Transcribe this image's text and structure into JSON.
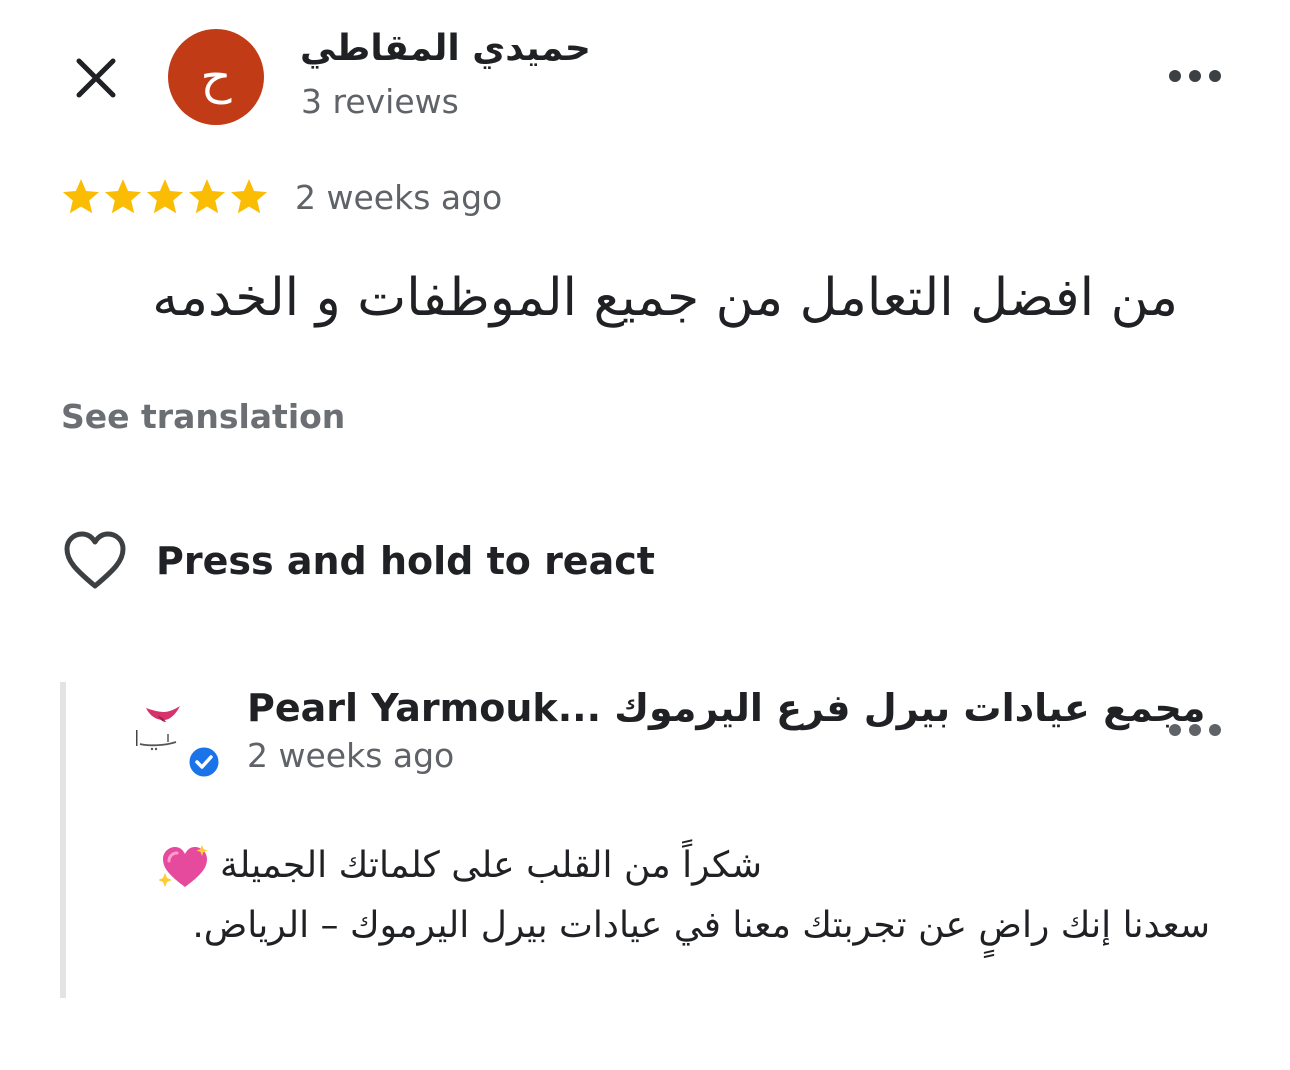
{
  "header": {
    "close_icon": "close-icon",
    "more_icon": "more-horizontal-icon"
  },
  "reviewer": {
    "avatar_letter": "ح",
    "avatar_color": "#c23b17",
    "name": "حميدي المقاطي",
    "meta": "3 reviews"
  },
  "review": {
    "rating": 5,
    "rating_max": 5,
    "star_color": "#fbbc04",
    "time_ago": "2 weeks ago",
    "text": "من افضل التعامل من جميع الموظفات و الخدمه",
    "see_translation": "See translation"
  },
  "react": {
    "icon": "heart-outline-icon",
    "label": "Press and hold to react"
  },
  "owner_reply": {
    "logo_icon": "pearls-logo",
    "logo_accent": "#d6336c",
    "verified_color": "#1a73e8",
    "name": "Pearl Yarmouk... مجمع عيادات بيرل فرع اليرموك",
    "time_ago": "2 weeks ago",
    "more_icon": "more-horizontal-icon",
    "line1": "شكراً من القلب على كلماتك الجميلة",
    "line1_emoji": "sparkling-heart-icon",
    "line2": "سعدنا إنك راضٍ عن تجربتك معنا في عيادات بيرل اليرموك – الرياض."
  }
}
